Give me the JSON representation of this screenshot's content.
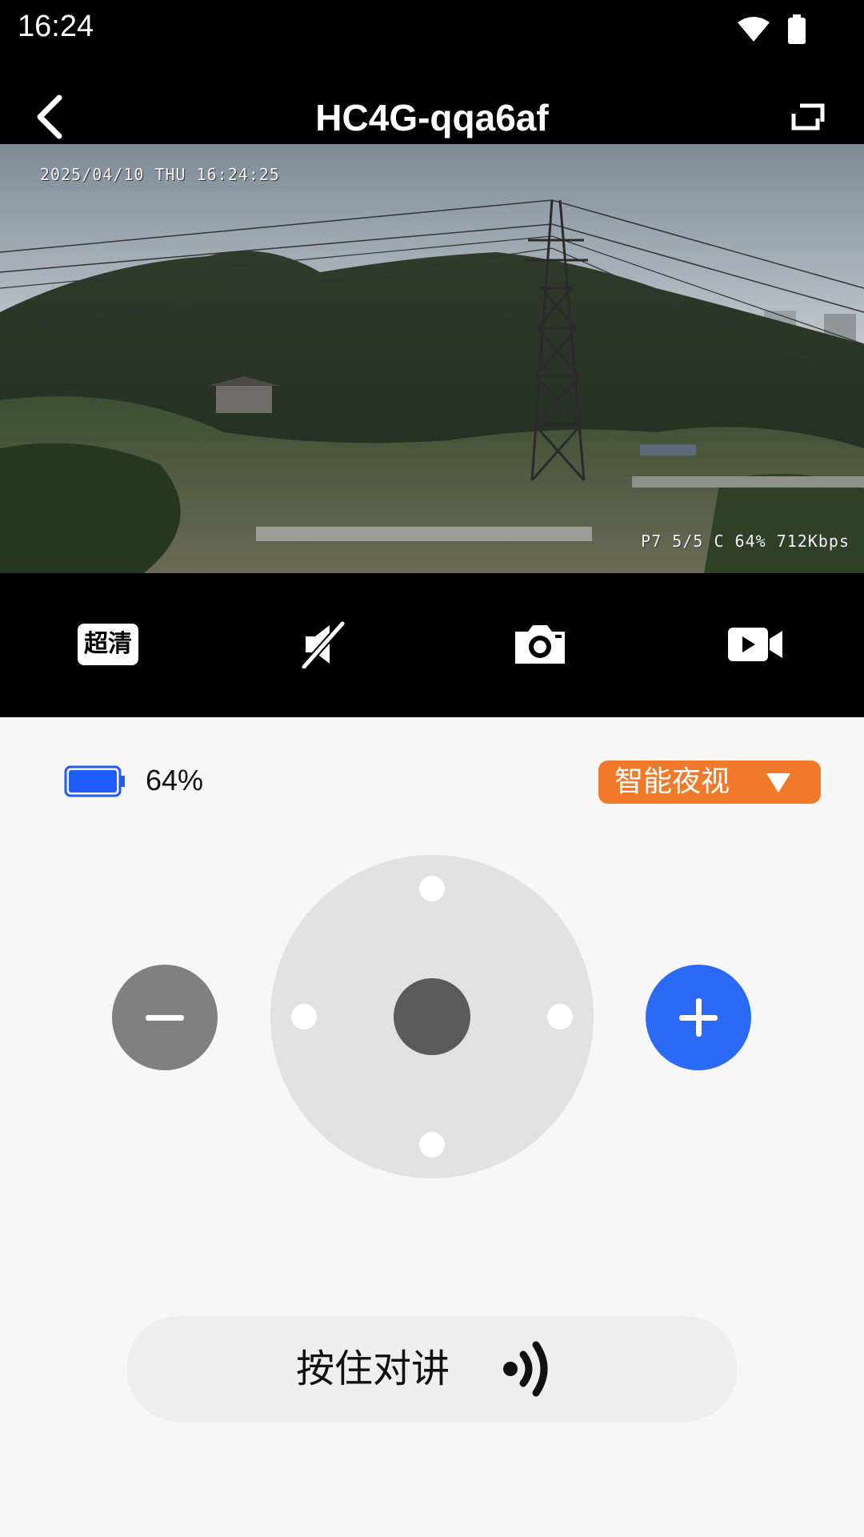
{
  "status_bar": {
    "time": "16:24",
    "icons": [
      "wifi-icon",
      "battery-icon"
    ]
  },
  "header": {
    "title": "HC4G-qqa6af",
    "back_icon": "chevron-left-icon",
    "fullscreen_icon": "fullscreen-icon"
  },
  "video": {
    "osd_timestamp": "2025/04/10 THU 16:24:25",
    "osd_stats": "P7 5/5 C 64%  712Kbps"
  },
  "toolbar": {
    "quality_label": "超清",
    "icons": [
      "mute-icon",
      "camera-icon",
      "video-record-icon"
    ]
  },
  "device": {
    "battery_percent": "64%",
    "battery_level": 0.64,
    "battery_color": "#1f5cff",
    "night_mode_label": "智能夜视",
    "night_mode_color": "#f07a2a"
  },
  "ptz": {
    "zoom_in_color": "#2a6af5",
    "zoom_out_color": "#808080"
  },
  "talk": {
    "label": "按住对讲",
    "icon": "sound-waves-icon"
  }
}
